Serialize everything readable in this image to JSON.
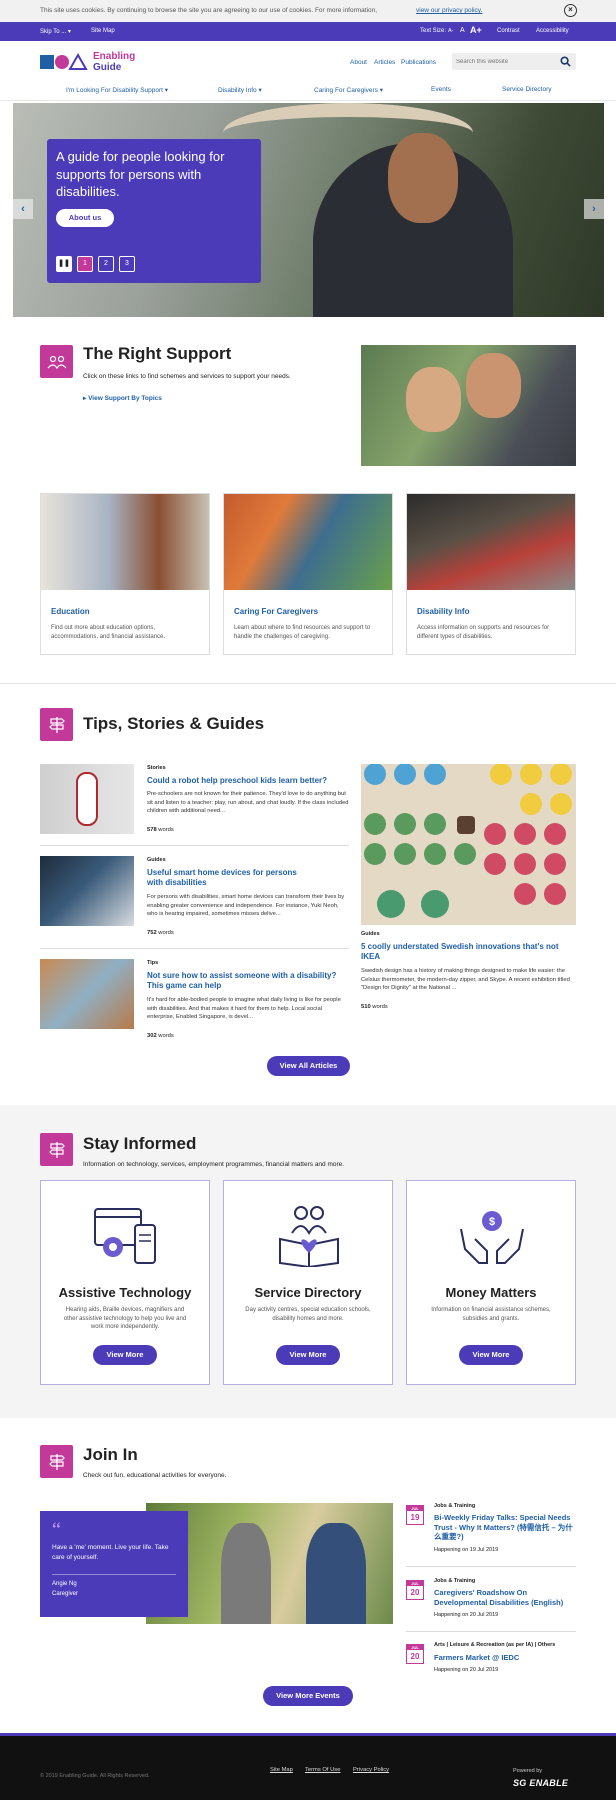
{
  "cookie": {
    "text": "This site uses cookies. By continuing to browse the site you are agreeing to our use of cookies. For more information,",
    "link": "view our privacy policy."
  },
  "topbar": {
    "skip_to": "Skip To ...",
    "site_map": "Site Map",
    "text_size": "Text Size:",
    "size_small": "A-",
    "size_mid": "A",
    "size_large": "A+",
    "contrast": "Contrast",
    "accessibility": "Accessibility"
  },
  "header": {
    "logo_line1": "Enabling",
    "logo_line2": "Guide",
    "links": [
      "About",
      "Articles",
      "Publications"
    ],
    "search_placeholder": "Search this website"
  },
  "nav": [
    "I'm Looking For Disability Support",
    "Disability Info",
    "Caring For Caregivers",
    "Events",
    "Service Directory"
  ],
  "hero": {
    "title": "A guide for people looking for supports for persons with disabilities.",
    "button": "About us",
    "slides": [
      "1",
      "2",
      "3"
    ]
  },
  "right_support": {
    "title": "The Right Support",
    "subtitle": "Click on these links to find schemes and services to support your needs.",
    "link": "View Support By Topics"
  },
  "support_cards": [
    {
      "title": "Education",
      "text": "Find out more about education options, accommodations, and financial assistance."
    },
    {
      "title": "Caring For Caregivers",
      "text": "Learn about where to find resources and support to handle the challenges of caregiving."
    },
    {
      "title": "Disability Info",
      "text": "Access information on supports and resources for different types of disabilities."
    }
  ],
  "tips": {
    "title": "Tips, Stories & Guides",
    "articles": [
      {
        "category": "Stories",
        "title": "Could a robot help preschool kids learn better?",
        "text": "Pre-schoolers are not known for their patience. They'd love to do anything but sit and listen to a teacher: play, run about, and chat loudly. If the class included children with additional need...",
        "words": "578",
        "words_label": "words"
      },
      {
        "category": "Guides",
        "title": "Useful smart home devices for persons with disabilities",
        "text": "For persons with disabilities, smart home devices can transform their lives by enabling greater convenience and independence. For instance, Yuki Neoh, who is hearing impaired, sometimes misses delive...",
        "words": "752",
        "words_label": "words"
      },
      {
        "category": "Tips",
        "title": "Not sure how to assist someone with a disability? This game can help",
        "text": "It's hard for able-bodied people to imagine what daily living is like for people with disabilities. And that makes it hard for them to help. Local social enterprise, Enabled Singapore, is devel...",
        "words": "302",
        "words_label": "words"
      }
    ],
    "feature": {
      "category": "Guides",
      "title": "5 coolly understated Swedish innovations that's not IKEA",
      "text": "Swedish design has a history of making things designed to make life easier: the Celsius thermometer, the modern-day zipper, and Skype. A recent exhibition titled \"Design for Dignity\" at the National ...",
      "words": "510",
      "words_label": "words"
    },
    "button": "View All Articles"
  },
  "stay_informed": {
    "title": "Stay Informed",
    "subtitle": "Information on technology, services, employment programmes, financial matters and more.",
    "cards": [
      {
        "title": "Assistive Technology",
        "text": "Hearing aids, Braille devices, magnifiers and other assistive technology to help you live and work more independently.",
        "button": "View More"
      },
      {
        "title": "Service Directory",
        "text": "Day activity centres, special education schools, disability homes and more.",
        "button": "View More"
      },
      {
        "title": "Money Matters",
        "text": "Information on financial assistance schemes, subsidies and grants.",
        "button": "View More"
      }
    ]
  },
  "join_in": {
    "title": "Join In",
    "subtitle": "Check out fun, educational activities for everyone.",
    "quote": "Have a 'me' moment. Live your life. Take care of yourself.",
    "quote_name": "Angie Ng",
    "quote_role": "Caregiver",
    "events": [
      {
        "month": "JUL",
        "day": "19",
        "category": "Jobs & Training",
        "title": "Bi-Weekly Friday Talks: Special Needs Trust - Why It Matters? (特需信托 – 为什么重要?)",
        "date": "Happening on 19 Jul 2019"
      },
      {
        "month": "JUL",
        "day": "20",
        "category": "Jobs & Training",
        "title": "Caregivers' Roadshow On Developmental Disabilities (English)",
        "date": "Happening on 20 Jul 2019"
      },
      {
        "month": "JUL",
        "day": "20",
        "category": "Arts | Leisure & Recreation (as per IA) | Others",
        "title": "Farmers Market @ IEDC",
        "date": "Happening on 20 Jul 2019"
      }
    ],
    "button": "View More Events"
  },
  "footer": {
    "copyright": "© 2019 Enabling Guide. All Rights Reserved.",
    "links": [
      "Site Map",
      "Terms Of Use",
      "Privacy Policy"
    ],
    "powered_by": "Powered by",
    "brand": "SG ENABLE"
  },
  "colors": {
    "accent": "#4c3bb8",
    "pink": "#c2399a",
    "link": "#1f5fa6",
    "footer": "#111111"
  }
}
